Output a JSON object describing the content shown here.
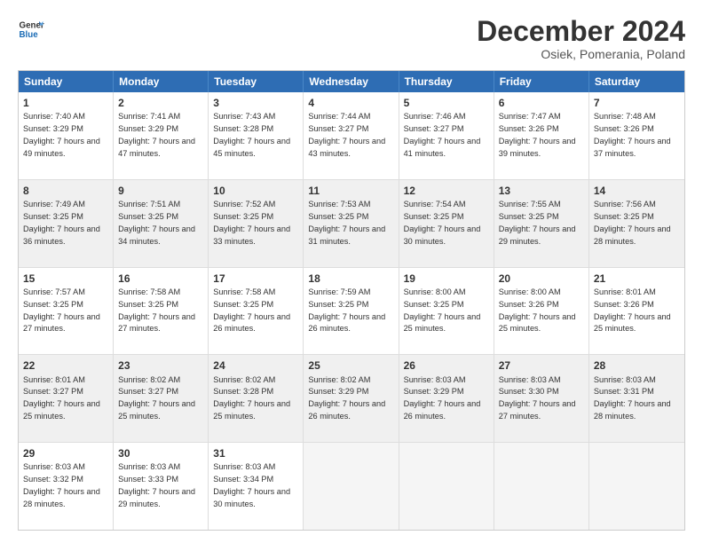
{
  "logo": {
    "line1": "General",
    "line2": "Blue"
  },
  "title": "December 2024",
  "subtitle": "Osiek, Pomerania, Poland",
  "header_days": [
    "Sunday",
    "Monday",
    "Tuesday",
    "Wednesday",
    "Thursday",
    "Friday",
    "Saturday"
  ],
  "weeks": [
    [
      {
        "day": "1",
        "sunrise": "Sunrise: 7:40 AM",
        "sunset": "Sunset: 3:29 PM",
        "daylight": "Daylight: 7 hours and 49 minutes.",
        "shaded": false
      },
      {
        "day": "2",
        "sunrise": "Sunrise: 7:41 AM",
        "sunset": "Sunset: 3:29 PM",
        "daylight": "Daylight: 7 hours and 47 minutes.",
        "shaded": false
      },
      {
        "day": "3",
        "sunrise": "Sunrise: 7:43 AM",
        "sunset": "Sunset: 3:28 PM",
        "daylight": "Daylight: 7 hours and 45 minutes.",
        "shaded": false
      },
      {
        "day": "4",
        "sunrise": "Sunrise: 7:44 AM",
        "sunset": "Sunset: 3:27 PM",
        "daylight": "Daylight: 7 hours and 43 minutes.",
        "shaded": false
      },
      {
        "day": "5",
        "sunrise": "Sunrise: 7:46 AM",
        "sunset": "Sunset: 3:27 PM",
        "daylight": "Daylight: 7 hours and 41 minutes.",
        "shaded": false
      },
      {
        "day": "6",
        "sunrise": "Sunrise: 7:47 AM",
        "sunset": "Sunset: 3:26 PM",
        "daylight": "Daylight: 7 hours and 39 minutes.",
        "shaded": false
      },
      {
        "day": "7",
        "sunrise": "Sunrise: 7:48 AM",
        "sunset": "Sunset: 3:26 PM",
        "daylight": "Daylight: 7 hours and 37 minutes.",
        "shaded": false
      }
    ],
    [
      {
        "day": "8",
        "sunrise": "Sunrise: 7:49 AM",
        "sunset": "Sunset: 3:25 PM",
        "daylight": "Daylight: 7 hours and 36 minutes.",
        "shaded": true
      },
      {
        "day": "9",
        "sunrise": "Sunrise: 7:51 AM",
        "sunset": "Sunset: 3:25 PM",
        "daylight": "Daylight: 7 hours and 34 minutes.",
        "shaded": true
      },
      {
        "day": "10",
        "sunrise": "Sunrise: 7:52 AM",
        "sunset": "Sunset: 3:25 PM",
        "daylight": "Daylight: 7 hours and 33 minutes.",
        "shaded": true
      },
      {
        "day": "11",
        "sunrise": "Sunrise: 7:53 AM",
        "sunset": "Sunset: 3:25 PM",
        "daylight": "Daylight: 7 hours and 31 minutes.",
        "shaded": true
      },
      {
        "day": "12",
        "sunrise": "Sunrise: 7:54 AM",
        "sunset": "Sunset: 3:25 PM",
        "daylight": "Daylight: 7 hours and 30 minutes.",
        "shaded": true
      },
      {
        "day": "13",
        "sunrise": "Sunrise: 7:55 AM",
        "sunset": "Sunset: 3:25 PM",
        "daylight": "Daylight: 7 hours and 29 minutes.",
        "shaded": true
      },
      {
        "day": "14",
        "sunrise": "Sunrise: 7:56 AM",
        "sunset": "Sunset: 3:25 PM",
        "daylight": "Daylight: 7 hours and 28 minutes.",
        "shaded": true
      }
    ],
    [
      {
        "day": "15",
        "sunrise": "Sunrise: 7:57 AM",
        "sunset": "Sunset: 3:25 PM",
        "daylight": "Daylight: 7 hours and 27 minutes.",
        "shaded": false
      },
      {
        "day": "16",
        "sunrise": "Sunrise: 7:58 AM",
        "sunset": "Sunset: 3:25 PM",
        "daylight": "Daylight: 7 hours and 27 minutes.",
        "shaded": false
      },
      {
        "day": "17",
        "sunrise": "Sunrise: 7:58 AM",
        "sunset": "Sunset: 3:25 PM",
        "daylight": "Daylight: 7 hours and 26 minutes.",
        "shaded": false
      },
      {
        "day": "18",
        "sunrise": "Sunrise: 7:59 AM",
        "sunset": "Sunset: 3:25 PM",
        "daylight": "Daylight: 7 hours and 26 minutes.",
        "shaded": false
      },
      {
        "day": "19",
        "sunrise": "Sunrise: 8:00 AM",
        "sunset": "Sunset: 3:25 PM",
        "daylight": "Daylight: 7 hours and 25 minutes.",
        "shaded": false
      },
      {
        "day": "20",
        "sunrise": "Sunrise: 8:00 AM",
        "sunset": "Sunset: 3:26 PM",
        "daylight": "Daylight: 7 hours and 25 minutes.",
        "shaded": false
      },
      {
        "day": "21",
        "sunrise": "Sunrise: 8:01 AM",
        "sunset": "Sunset: 3:26 PM",
        "daylight": "Daylight: 7 hours and 25 minutes.",
        "shaded": false
      }
    ],
    [
      {
        "day": "22",
        "sunrise": "Sunrise: 8:01 AM",
        "sunset": "Sunset: 3:27 PM",
        "daylight": "Daylight: 7 hours and 25 minutes.",
        "shaded": true
      },
      {
        "day": "23",
        "sunrise": "Sunrise: 8:02 AM",
        "sunset": "Sunset: 3:27 PM",
        "daylight": "Daylight: 7 hours and 25 minutes.",
        "shaded": true
      },
      {
        "day": "24",
        "sunrise": "Sunrise: 8:02 AM",
        "sunset": "Sunset: 3:28 PM",
        "daylight": "Daylight: 7 hours and 25 minutes.",
        "shaded": true
      },
      {
        "day": "25",
        "sunrise": "Sunrise: 8:02 AM",
        "sunset": "Sunset: 3:29 PM",
        "daylight": "Daylight: 7 hours and 26 minutes.",
        "shaded": true
      },
      {
        "day": "26",
        "sunrise": "Sunrise: 8:03 AM",
        "sunset": "Sunset: 3:29 PM",
        "daylight": "Daylight: 7 hours and 26 minutes.",
        "shaded": true
      },
      {
        "day": "27",
        "sunrise": "Sunrise: 8:03 AM",
        "sunset": "Sunset: 3:30 PM",
        "daylight": "Daylight: 7 hours and 27 minutes.",
        "shaded": true
      },
      {
        "day": "28",
        "sunrise": "Sunrise: 8:03 AM",
        "sunset": "Sunset: 3:31 PM",
        "daylight": "Daylight: 7 hours and 28 minutes.",
        "shaded": true
      }
    ],
    [
      {
        "day": "29",
        "sunrise": "Sunrise: 8:03 AM",
        "sunset": "Sunset: 3:32 PM",
        "daylight": "Daylight: 7 hours and 28 minutes.",
        "shaded": false
      },
      {
        "day": "30",
        "sunrise": "Sunrise: 8:03 AM",
        "sunset": "Sunset: 3:33 PM",
        "daylight": "Daylight: 7 hours and 29 minutes.",
        "shaded": false
      },
      {
        "day": "31",
        "sunrise": "Sunrise: 8:03 AM",
        "sunset": "Sunset: 3:34 PM",
        "daylight": "Daylight: 7 hours and 30 minutes.",
        "shaded": false
      },
      {
        "day": "",
        "sunrise": "",
        "sunset": "",
        "daylight": "",
        "shaded": false,
        "empty": true
      },
      {
        "day": "",
        "sunrise": "",
        "sunset": "",
        "daylight": "",
        "shaded": false,
        "empty": true
      },
      {
        "day": "",
        "sunrise": "",
        "sunset": "",
        "daylight": "",
        "shaded": false,
        "empty": true
      },
      {
        "day": "",
        "sunrise": "",
        "sunset": "",
        "daylight": "",
        "shaded": false,
        "empty": true
      }
    ]
  ]
}
